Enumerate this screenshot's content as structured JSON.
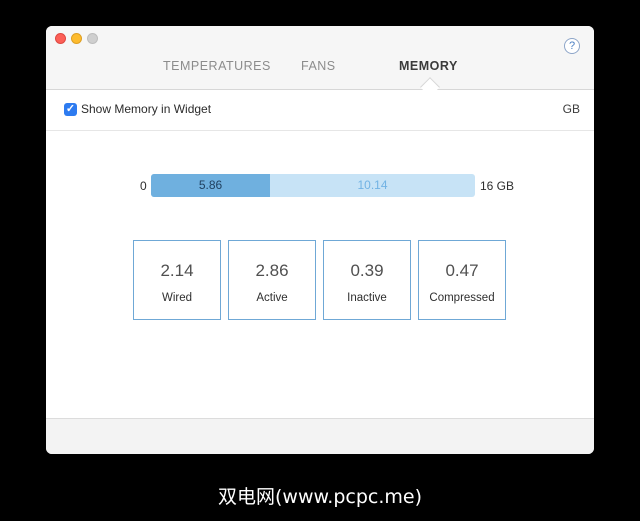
{
  "window": {
    "tabs": [
      {
        "label": "TEMPERATURES",
        "active": false
      },
      {
        "label": "FANS",
        "active": false
      },
      {
        "label": "MEMORY",
        "active": true
      }
    ],
    "help_label": "?"
  },
  "options": {
    "show_in_widget": {
      "label": "Show Memory in Widget",
      "checked": true
    },
    "unit": "GB"
  },
  "memory_bar": {
    "min_label": "0",
    "max_label": "16 GB",
    "total": 16,
    "used": 5.86,
    "used_label": "5.86",
    "free": 10.14,
    "free_label": "10.14"
  },
  "stats": [
    {
      "value": "2.14",
      "label": "Wired"
    },
    {
      "value": "2.86",
      "label": "Active"
    },
    {
      "value": "0.39",
      "label": "Inactive"
    },
    {
      "value": "0.47",
      "label": "Compressed"
    }
  ],
  "watermark": "双电网(www.pcpc.me)",
  "colors": {
    "accent": "#2d7bf0",
    "used_fill": "#6fb0df",
    "free_fill": "#c7e3f6",
    "stat_border": "#6fa8d6"
  }
}
